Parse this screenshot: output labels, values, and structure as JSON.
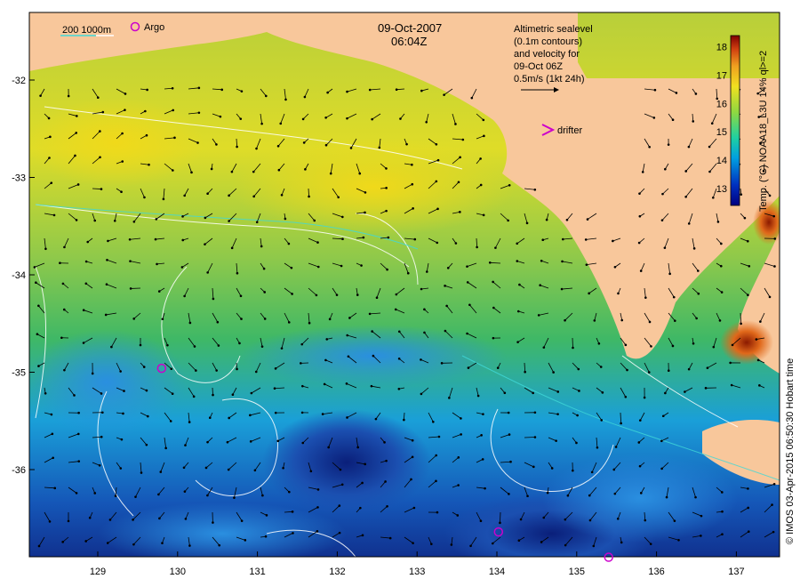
{
  "map": {
    "date": "09-Oct-2007",
    "time": "06:04Z",
    "scale_label": "200  1000m",
    "argo_label": "Argo",
    "drifter_label": "drifter",
    "altimetry_note": [
      "Altimetric sealevel",
      "(0.1m contours)",
      "and velocity for",
      "09-Oct 06Z",
      "0.5m/s (1kt 24h)"
    ],
    "colorbar_title": "Temp. (°C) NOAA18_L3U 14% ql>=2",
    "credit": "© IMOS 03-Apr-2015 06:50:30 Hobart time",
    "colors": {
      "land": "#f8c79b",
      "argo_marker": "#cc00cc",
      "drifter_marker": "#cc00cc",
      "sst_high": "#8b1a00",
      "sst_low": "#00008b"
    }
  },
  "x_axis": {
    "unit": "degrees E",
    "ticks": [
      {
        "value": 129,
        "label": "129"
      },
      {
        "value": 130,
        "label": "130"
      },
      {
        "value": 131,
        "label": "131"
      },
      {
        "value": 132,
        "label": "132"
      },
      {
        "value": 133,
        "label": "133"
      },
      {
        "value": 134,
        "label": "134"
      },
      {
        "value": 135,
        "label": "135"
      },
      {
        "value": 136,
        "label": "136"
      },
      {
        "value": 137,
        "label": "137"
      }
    ]
  },
  "y_axis": {
    "unit": "degrees latitude",
    "ticks": [
      {
        "value": -32,
        "label": "-32"
      },
      {
        "value": -33,
        "label": "-33"
      },
      {
        "value": -34,
        "label": "-34"
      },
      {
        "value": -35,
        "label": "-35"
      },
      {
        "value": -36,
        "label": "-36"
      }
    ]
  },
  "colorbar": {
    "ticks": [
      {
        "value": 18,
        "label": "18"
      },
      {
        "value": 17,
        "label": "17"
      },
      {
        "value": 16,
        "label": "16"
      },
      {
        "value": 15,
        "label": "15"
      },
      {
        "value": 14,
        "label": "14"
      },
      {
        "value": 13,
        "label": "13"
      }
    ],
    "range": [
      12.4,
      18.4
    ]
  },
  "argo_floats": [
    {
      "lon": 129.8,
      "lat": -34.96
    },
    {
      "lon": 134.02,
      "lat": -36.64
    },
    {
      "lon": 135.4,
      "lat": -36.9
    }
  ]
}
